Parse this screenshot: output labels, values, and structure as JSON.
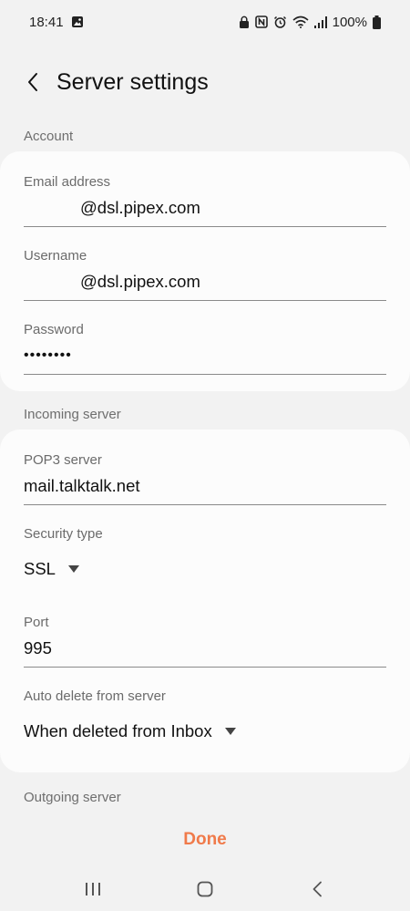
{
  "status_bar": {
    "time": "18:41",
    "battery": "100%"
  },
  "header": {
    "title": "Server settings"
  },
  "account": {
    "section_label": "Account",
    "email": {
      "label": "Email address",
      "value": "@dsl.pipex.com"
    },
    "username": {
      "label": "Username",
      "value": "@dsl.pipex.com"
    },
    "password": {
      "label": "Password",
      "value": "••••••••"
    }
  },
  "incoming": {
    "section_label": "Incoming server",
    "pop3": {
      "label": "POP3 server",
      "value": "mail.talktalk.net"
    },
    "security": {
      "label": "Security type",
      "value": "SSL"
    },
    "port": {
      "label": "Port",
      "value": "995"
    },
    "auto_delete": {
      "label": "Auto delete from server",
      "value": "When deleted from Inbox"
    }
  },
  "outgoing": {
    "section_label": "Outgoing server"
  },
  "footer": {
    "done_label": "Done"
  },
  "colors": {
    "accent": "#f07a4a",
    "background": "#f2f2f2",
    "card": "#fcfcfc"
  },
  "icons": {
    "status_left": [
      "image-icon"
    ],
    "status_right": [
      "lock-icon",
      "nfc-icon",
      "alarm-icon",
      "wifi-icon",
      "signal-icon",
      "battery-icon"
    ],
    "nav": [
      "recents-icon",
      "home-icon",
      "back-icon"
    ]
  }
}
